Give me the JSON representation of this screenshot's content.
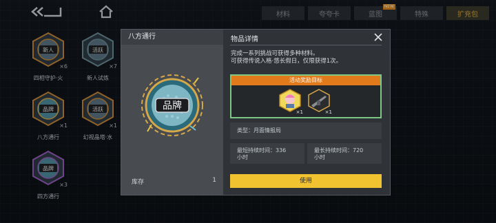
{
  "tabs": [
    {
      "label": "材料"
    },
    {
      "label": "夸夸卡"
    },
    {
      "label": "蓝图",
      "badge": "NEW"
    },
    {
      "label": "特殊"
    },
    {
      "label": "扩充包",
      "active": true
    }
  ],
  "items": [
    {
      "name": "四相守护·火",
      "count": "×6",
      "badge_text": "新人",
      "color": "#c98a3a"
    },
    {
      "name": "新人试炼",
      "count": "×7",
      "badge_text": "活跃",
      "color": "#6b8f99"
    },
    {
      "name": "八方通行",
      "count": "×1",
      "badge_text": "品牌",
      "color": "#c98a3a"
    },
    {
      "name": "幻视晶塔·水",
      "count": "×1",
      "badge_text": "活跃",
      "color": "#c98a3a"
    },
    {
      "name": "四方通行",
      "count": "×3",
      "badge_text": "品牌",
      "color": "#9a5fc2"
    }
  ],
  "modal": {
    "item_title": "八方通行",
    "icon_text": "品牌",
    "stock_label": "库存",
    "stock_value": "1",
    "detail_title": "物品详情",
    "description_line1": "完成一系列挑战可获得多种材料。",
    "description_line2": "可获得传说入格·悠长假日，仅限获得1次。",
    "reward_header": "活动奖励目标",
    "rewards": [
      {
        "count": "×1"
      },
      {
        "count": "×1"
      }
    ],
    "type_text": "类型：月面情报局",
    "min_duration_line1": "最短持续时间：336",
    "min_duration_line2": "小时",
    "max_duration_line1": "最长持续时间：720",
    "max_duration_line2": "小时",
    "use_button": "使用"
  },
  "colors": {
    "accent_gold": "#f1c330",
    "reward_orange": "#e07a1a",
    "reward_border": "#7ec886"
  }
}
